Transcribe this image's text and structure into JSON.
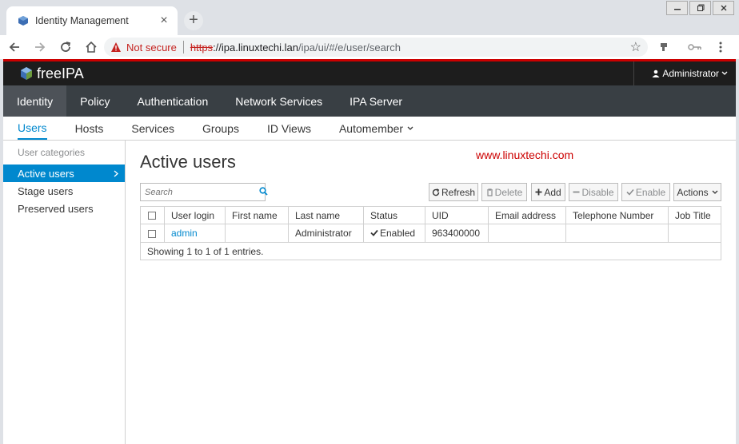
{
  "browser": {
    "tab_title": "Identity Management",
    "close_tab": "×",
    "new_tab": "+",
    "not_secure": "Not secure",
    "url_scheme": "https",
    "url_host": "://ipa.linuxtechi.lan",
    "url_path": "/ipa/ui/#/e/user/search"
  },
  "masthead": {
    "brand": "freeIPA",
    "user_menu": "Administrator"
  },
  "primary_nav": [
    "Identity",
    "Policy",
    "Authentication",
    "Network Services",
    "IPA Server"
  ],
  "secondary_nav": [
    "Users",
    "Hosts",
    "Services",
    "Groups",
    "ID Views",
    "Automember"
  ],
  "sidebar": {
    "heading": "User categories",
    "items": [
      "Active users",
      "Stage users",
      "Preserved users"
    ]
  },
  "page": {
    "title": "Active users",
    "watermark": "www.linuxtechi.com",
    "search_placeholder": "Search"
  },
  "buttons": {
    "refresh": "Refresh",
    "delete": "Delete",
    "add": "Add",
    "disable": "Disable",
    "enable": "Enable",
    "actions": "Actions"
  },
  "table": {
    "columns": [
      "User login",
      "First name",
      "Last name",
      "Status",
      "UID",
      "Email address",
      "Telephone Number",
      "Job Title"
    ],
    "rows": [
      [
        "admin",
        "",
        "Administrator",
        "Enabled",
        "963400000",
        "",
        "",
        ""
      ]
    ],
    "footer": "Showing 1 to 1 of 1 entries."
  },
  "colors": {
    "accent": "#0088ce",
    "masthead": "#1d1d1d",
    "primary_nav": "#393f44",
    "warning": "#c5221f"
  }
}
